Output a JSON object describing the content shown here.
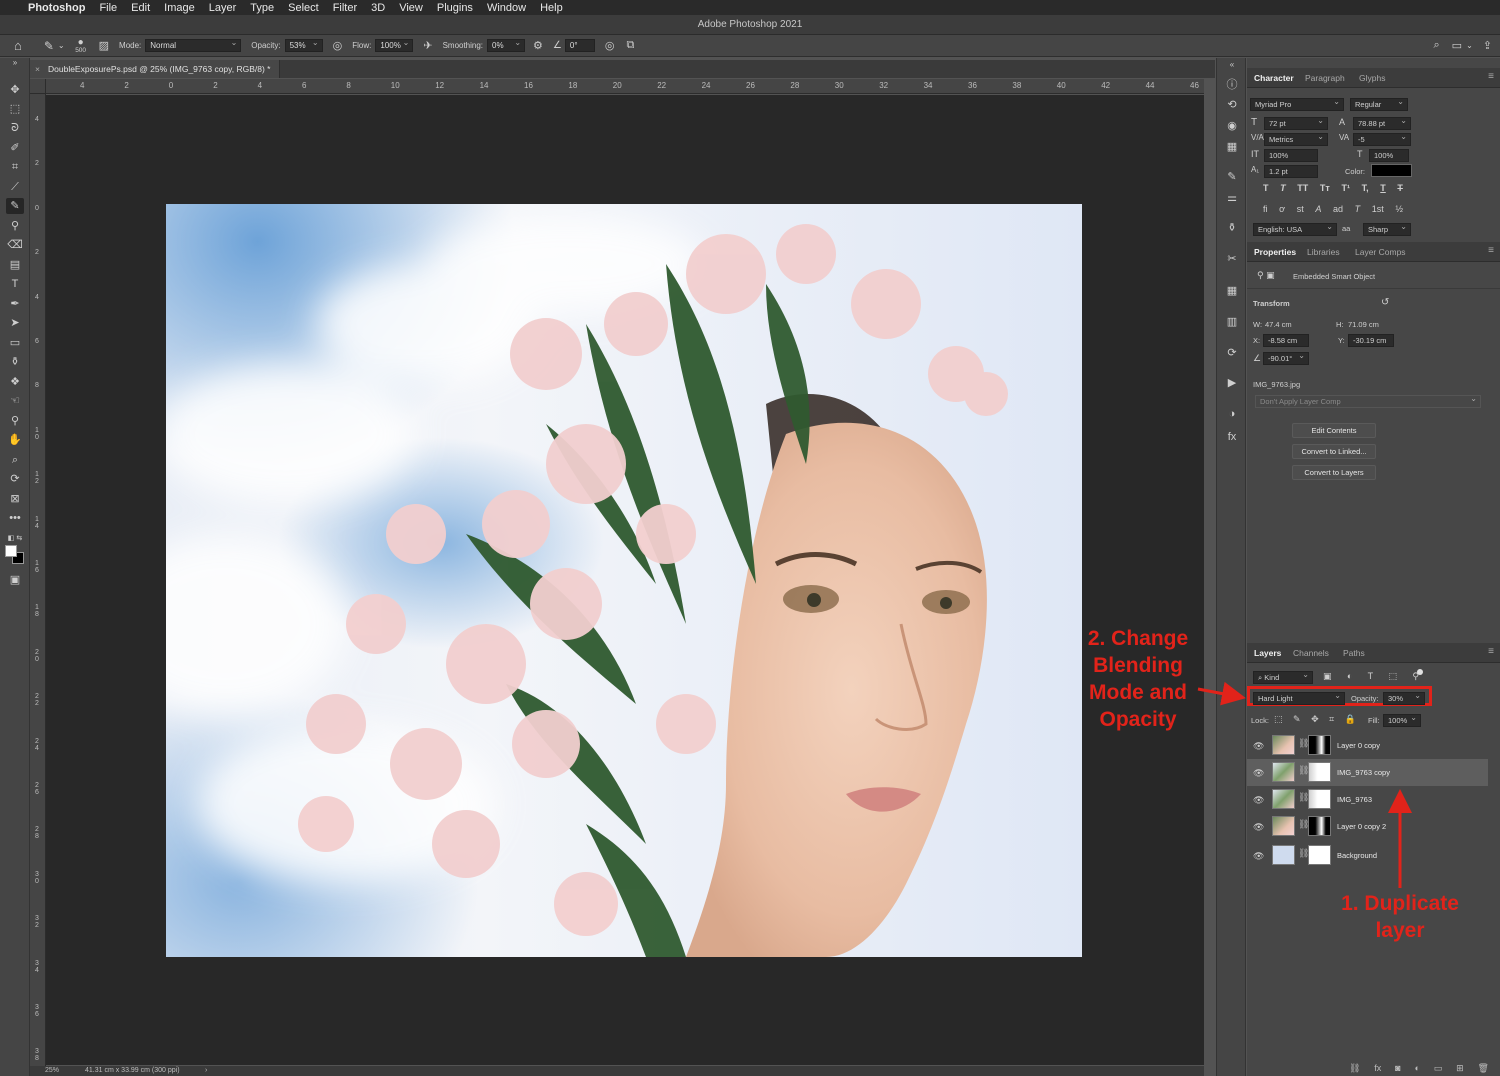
{
  "menubar": {
    "apple": "",
    "app": "Photoshop",
    "items": [
      "File",
      "Edit",
      "Image",
      "Layer",
      "Type",
      "Select",
      "Filter",
      "3D",
      "View",
      "Plugins",
      "Window",
      "Help"
    ]
  },
  "window": {
    "title": "Adobe Photoshop 2021"
  },
  "options": {
    "brush_size": "500",
    "mode_label": "Mode:",
    "mode": "Normal",
    "opacity_label": "Opacity:",
    "opacity": "53%",
    "flow_label": "Flow:",
    "flow": "100%",
    "smoothing_label": "Smoothing:",
    "smoothing": "0%",
    "angle": "0°"
  },
  "document": {
    "tab_title": "DoubleExposurePs.psd @ 25% (IMG_9763 copy, RGB/8) *"
  },
  "rulers": {
    "h": [
      "4",
      "2",
      "0",
      "2",
      "4",
      "6",
      "8",
      "10",
      "12",
      "14",
      "16",
      "18",
      "20",
      "22",
      "24",
      "26",
      "28",
      "30",
      "32",
      "34",
      "36",
      "38",
      "40",
      "42",
      "44",
      "46"
    ],
    "v": [
      "4",
      "2",
      "0",
      "2",
      "4",
      "6",
      "8",
      "10",
      "12",
      "14",
      "16",
      "18",
      "20",
      "22",
      "24",
      "26",
      "28",
      "30",
      "32",
      "34",
      "36",
      "38"
    ]
  },
  "status": {
    "zoom": "25%",
    "doc_info": "41.31 cm x 33.99 cm (300 ppi)"
  },
  "character": {
    "tabs": [
      "Character",
      "Paragraph",
      "Glyphs"
    ],
    "font": "Myriad Pro",
    "style": "Regular",
    "size": "72 pt",
    "leading": "78.88 pt",
    "kerning": "Metrics",
    "tracking": "-5",
    "vscale": "100%",
    "hscale": "100%",
    "baseline": "1.2 pt",
    "color_label": "Color:",
    "language": "English: USA",
    "aa_label": "aa",
    "antialias": "Sharp",
    "style_buttons": [
      "T",
      "T",
      "TT",
      "Tт",
      "T¹",
      "T,",
      "T",
      "T"
    ],
    "ot_buttons": [
      "fi",
      "ơ",
      "st",
      "A",
      "ad",
      "T",
      "1st",
      "½"
    ]
  },
  "properties": {
    "tabs": [
      "Properties",
      "Libraries",
      "Layer Comps"
    ],
    "kind": "Embedded Smart Object",
    "transform_label": "Transform",
    "w_label": "W:",
    "w": "47.4 cm",
    "h_label": "H:",
    "h": "71.09 cm",
    "x_label": "X:",
    "x": "-8.58 cm",
    "y_label": "Y:",
    "y": "-30.19 cm",
    "angle": "-90.01°",
    "file": "IMG_9763.jpg",
    "comp": "Don't Apply Layer Comp",
    "buttons": [
      "Edit Contents",
      "Convert to Linked...",
      "Convert to Layers"
    ]
  },
  "layers": {
    "tabs": [
      "Layers",
      "Channels",
      "Paths"
    ],
    "filter": "Kind",
    "blend_mode": "Hard Light",
    "opacity_label": "Opacity:",
    "opacity": "30%",
    "lock_label": "Lock:",
    "fill_label": "Fill:",
    "fill": "100%",
    "rows": [
      {
        "name": "Layer 0 copy"
      },
      {
        "name": "IMG_9763 copy"
      },
      {
        "name": "IMG_9763"
      },
      {
        "name": "Layer 0 copy 2"
      },
      {
        "name": "Background"
      }
    ]
  },
  "annotations": {
    "blend": [
      "2. Change",
      "Blending",
      "Mode and",
      "Opacity"
    ],
    "duplicate": [
      "1. Duplicate",
      "layer"
    ]
  },
  "colors": {
    "annotation": "#e2231a",
    "selected_row": "#5e5e5e",
    "panel_bg": "#474747"
  }
}
